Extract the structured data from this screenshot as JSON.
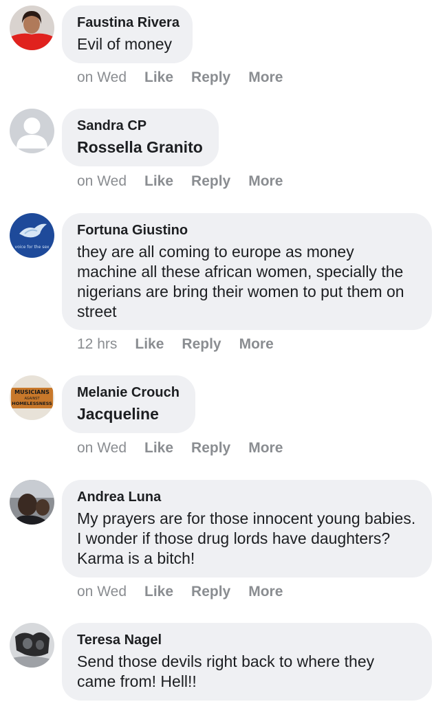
{
  "comments": [
    {
      "author": "Faustina Rivera",
      "text": "Evil of money",
      "time": "on Wed",
      "like": "Like",
      "reply": "Reply",
      "more": "More",
      "avatar": "profile-photo-red"
    },
    {
      "author": "Sandra CP",
      "text": "Rossella Granito",
      "time": "on Wed",
      "like": "Like",
      "reply": "Reply",
      "more": "More",
      "avatar": "default-avatar"
    },
    {
      "author": "Fortuna Giustino",
      "text": "they are all coming to europe as money machine all these african women, specially the nigerians are bring their women to put them on street",
      "time": "12 hrs",
      "like": "Like",
      "reply": "Reply",
      "more": "More",
      "avatar": "dove-logo"
    },
    {
      "author": "Melanie Crouch",
      "text": "Jacqueline",
      "time": "on Wed",
      "like": "Like",
      "reply": "Reply",
      "more": "More",
      "avatar": "musicians-logo"
    },
    {
      "author": "Andrea Luna",
      "text": "My prayers are for those innocent young babies. I wonder if those drug lords have daughters? Karma is a bitch!",
      "time": "on Wed",
      "like": "Like",
      "reply": "Reply",
      "more": "More",
      "avatar": "profile-photo-dark"
    },
    {
      "author": "Teresa Nagel",
      "text": "Send those devils right back to where they came from! Hell!!",
      "time": "",
      "like": "",
      "reply": "",
      "more": "",
      "avatar": "profile-photo-grey"
    }
  ],
  "avatar_labels": {
    "dove_logo_text": "voice for the sex",
    "musicians_logo_line1": "MUSICIANS",
    "musicians_logo_line2": "AGAINST",
    "musicians_logo_line3": "HOMELESSNESS"
  },
  "colors": {
    "bubble": "#eff0f3",
    "text": "#1c1e21",
    "meta": "#8a8d91"
  }
}
